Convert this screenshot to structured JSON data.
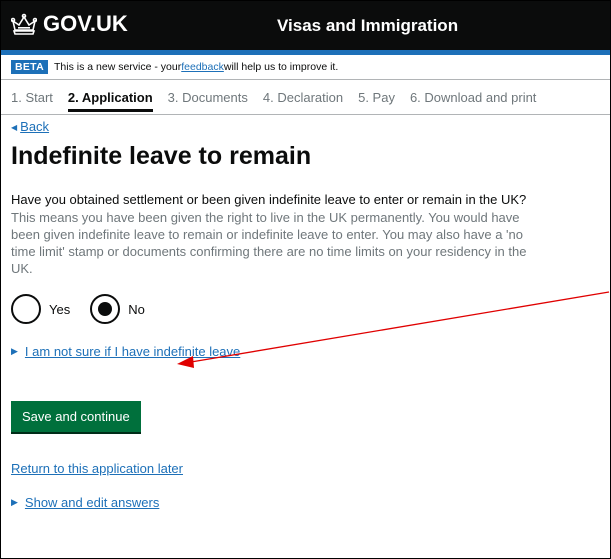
{
  "header": {
    "logo_text": "GOV.UK",
    "service_name": "Visas and Immigration"
  },
  "beta_banner": {
    "tag": "BETA",
    "text_before": "This is a new service - your ",
    "link": "feedback",
    "text_after": " will help us to improve it."
  },
  "steps": [
    {
      "label": "1. Start"
    },
    {
      "label": "2. Application"
    },
    {
      "label": "3. Documents"
    },
    {
      "label": "4. Declaration"
    },
    {
      "label": "5. Pay"
    },
    {
      "label": "6. Download and print"
    }
  ],
  "back_label": "Back",
  "page_title": "Indefinite leave to remain",
  "question": "Have you obtained settlement or been given indefinite leave to enter or remain in the UK?",
  "hint": "This means you have been given the right to live in the UK permanently. You would have been given indefinite leave to remain or indefinite leave to enter. You may also have a 'no time limit' stamp or documents confirming there are no time limits on your residency in the UK.",
  "radios": {
    "yes": "Yes",
    "no": "No",
    "selected": "No"
  },
  "details_summary": "I am not sure if I have indefinite leave",
  "save_button": "Save and continue",
  "return_link": "Return to this application later",
  "show_edit": "Show and edit answers",
  "colors": {
    "header_bg": "#0b0c0c",
    "accent_blue": "#1d70b8",
    "button_green": "#00703c",
    "annotation_arrow": "#e00000"
  },
  "icons": [
    "crown-icon",
    "back-triangle-icon",
    "disclosure-triangle-icon"
  ]
}
